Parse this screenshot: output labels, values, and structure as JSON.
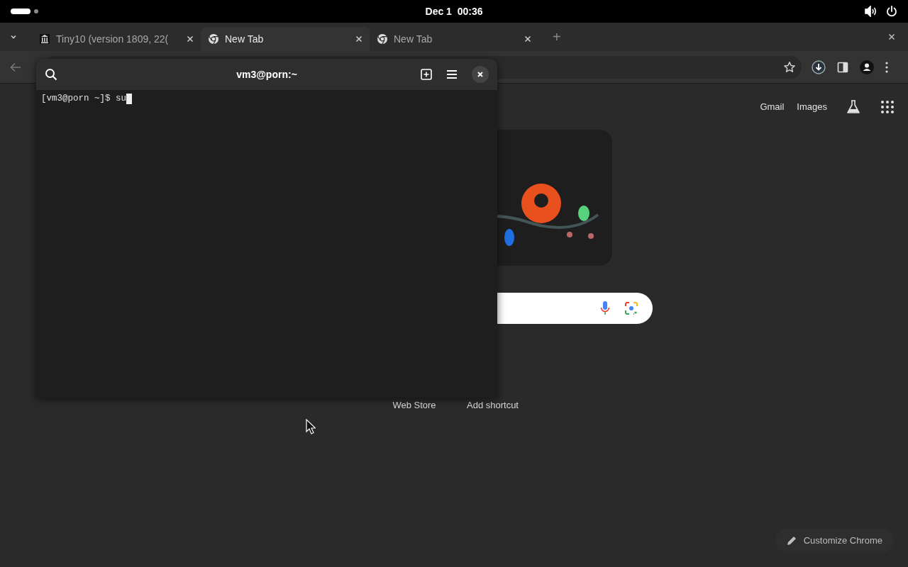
{
  "top_bar": {
    "clock": "Dec 1  00:36"
  },
  "browser": {
    "tabs": [
      {
        "title": "Tiny10 (version 1809, 22(",
        "selected": false
      },
      {
        "title": "New Tab",
        "selected": true
      },
      {
        "title": "New Tab",
        "selected": false
      }
    ],
    "new_tab_button": "+",
    "page": {
      "links": [
        "Gmail",
        "Images"
      ],
      "shortcuts": [
        "Web Store",
        "Add shortcut"
      ],
      "customize_button": "Customize Chrome",
      "doodle": {
        "kind": "picture"
      }
    }
  },
  "terminal": {
    "title": "vm3@porn:~",
    "prompt": "[vm3@porn ~]$ ",
    "input": "su"
  }
}
